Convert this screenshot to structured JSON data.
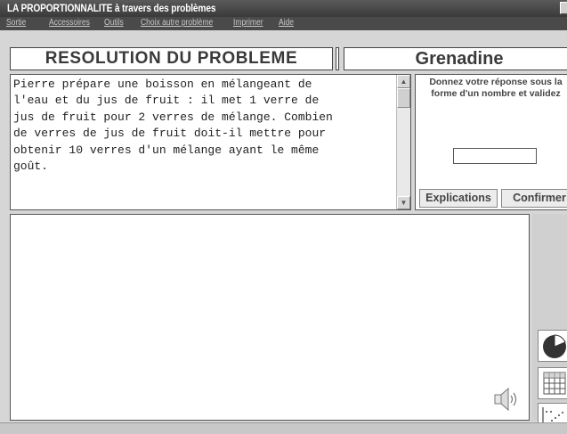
{
  "window": {
    "title": "LA PROPORTIONNALITE à travers des problèmes"
  },
  "menu": {
    "items": [
      "Sortie",
      "Accessoires",
      "Outils",
      "Choix autre problème",
      "Imprimer",
      "Aide"
    ]
  },
  "header": {
    "section_title": "RESOLUTION DU PROBLEME",
    "problem_name": "Grenadine"
  },
  "problem": {
    "lines": [
      "Pierre prépare une boisson en mélangeant de",
      "l'eau et du jus de fruit : il met 1 verre de",
      "jus de fruit pour 2 verres de mélange. Combien",
      "de verres de jus de fruit doit-il mettre pour",
      "obtenir 10 verres d'un mélange ayant le même",
      "goût."
    ]
  },
  "answer": {
    "instruction": "Donnez votre réponse sous la forme d'un nombre  et validez",
    "value": "",
    "explain_label": "Explications",
    "confirm_label": "Confirmer"
  },
  "tools": [
    "pie-chart-icon",
    "grid-table-icon",
    "scatter-plot-icon",
    "speaker-icon"
  ]
}
